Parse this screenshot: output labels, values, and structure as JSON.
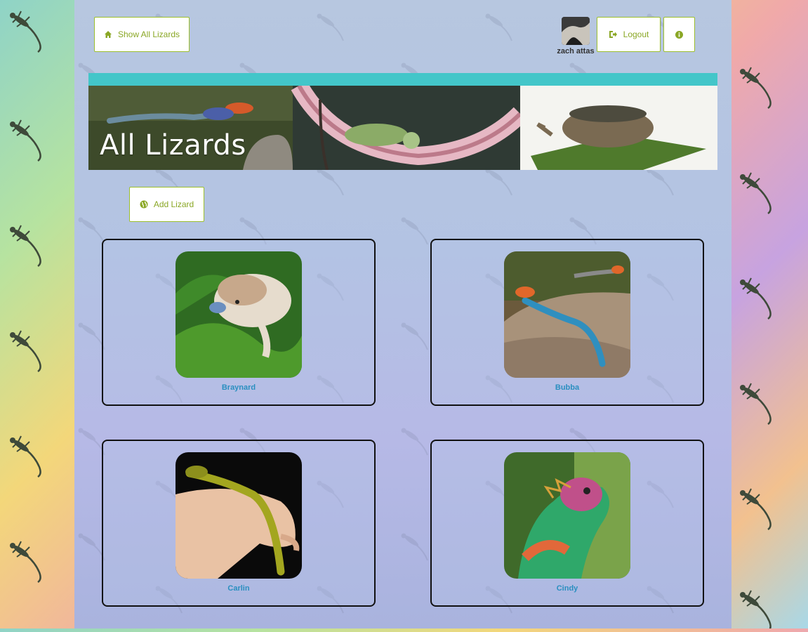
{
  "nav": {
    "show_all_label": "Show All Lizards",
    "logout_label": "Logout",
    "username": "zach attas"
  },
  "banner": {
    "title": "All Lizards"
  },
  "actions": {
    "add_label": "Add Lizard"
  },
  "lizards": [
    {
      "name": "Braynard"
    },
    {
      "name": "Bubba"
    },
    {
      "name": "Carlin"
    },
    {
      "name": "Cindy"
    }
  ],
  "colors": {
    "accent": "#8aa725",
    "banner_bar": "#43c6c9",
    "link": "#2a8fc0"
  }
}
